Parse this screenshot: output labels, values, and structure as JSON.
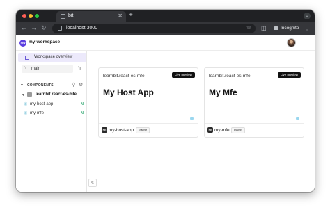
{
  "browser": {
    "tab_title": "bit",
    "url": "localhost:3000",
    "incognito_label": "Incognito"
  },
  "workspace": {
    "avatar_text": "mw",
    "name": "my-workspace"
  },
  "sidebar": {
    "overview_label": "Workspace overview",
    "lane": "main",
    "components_header": "COMPONENTS",
    "scope": "learnbit.react-es-mfe",
    "components": [
      {
        "name": "my-host-app",
        "status": "N"
      },
      {
        "name": "my-mfe",
        "status": "N"
      }
    ],
    "collapse_glyph": "«"
  },
  "cards": [
    {
      "scope": "learnbit.react-es-mfe",
      "badge": "Live preview",
      "title": "My Host App",
      "owner_initials": "RE",
      "name": "my-host-app",
      "version": "latest"
    },
    {
      "scope": "learnbit.react-es-mfe",
      "badge": "Live preview",
      "title": "My Mfe",
      "owner_initials": "RE",
      "name": "my-mfe",
      "version": "latest"
    }
  ],
  "colors": {
    "accent": "#5b3ee0",
    "selected_bg": "#ece9fb",
    "status_new": "#25a36a",
    "component_icon": "#3fa9c9"
  }
}
